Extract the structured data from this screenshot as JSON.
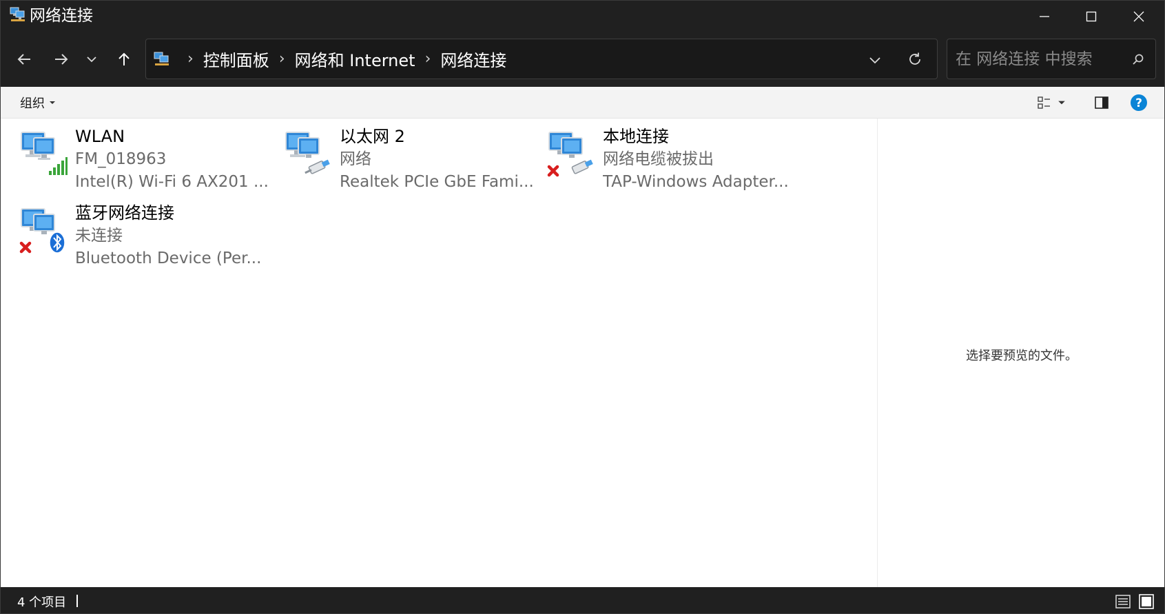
{
  "window": {
    "title": "网络连接"
  },
  "nav": {
    "breadcrumbs": [
      "控制面板",
      "网络和 Internet",
      "网络连接"
    ],
    "separator": "›"
  },
  "search": {
    "placeholder": "在 网络连接 中搜索"
  },
  "cmdbar": {
    "organize_label": "组织"
  },
  "connections": [
    {
      "name": "WLAN",
      "status": "FM_018963",
      "device": "Intel(R) Wi-Fi 6 AX201 ...",
      "type": "wifi",
      "disconnected": false
    },
    {
      "name": "以太网 2",
      "status": "网络",
      "device": "Realtek PCIe GbE Fami...",
      "type": "ethernet",
      "disconnected": false
    },
    {
      "name": "本地连接",
      "status": "网络电缆被拔出",
      "device": "TAP-Windows Adapter...",
      "type": "ethernet",
      "disconnected": true
    },
    {
      "name": "蓝牙网络连接",
      "status": "未连接",
      "device": "Bluetooth Device (Per...",
      "type": "bluetooth",
      "disconnected": true
    }
  ],
  "preview": {
    "message": "选择要预览的文件。"
  },
  "status": {
    "item_count": "4 个项目"
  },
  "colors": {
    "titlebar_bg": "#202020",
    "content_bg": "#ffffff",
    "help_blue": "#0a84d6",
    "disconnect_red": "#d81e1e",
    "signal_green": "#3aa53a",
    "bluetooth_blue": "#1c6fd6"
  },
  "icons": {
    "title": "network-connections-icon",
    "back": "arrow-left-icon",
    "forward": "arrow-right-icon",
    "recent": "chevron-down-icon",
    "up": "arrow-up-icon",
    "refresh": "refresh-icon",
    "search": "search-icon",
    "help": "help-icon"
  }
}
